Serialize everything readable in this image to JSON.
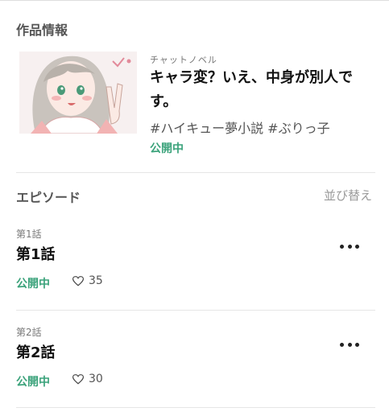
{
  "work_section": {
    "title": "作品情報",
    "category": "チャットノベル",
    "work_title": "キャラ変？いえ、中身が別人です。",
    "tags": "#ハイキュー夢小説 #ぶりっ子",
    "status": "公開中"
  },
  "episodes_section": {
    "title": "エピソード",
    "sort_label": "並び替え",
    "episodes": [
      {
        "number": "第1話",
        "title": "第1話",
        "status": "公開中",
        "likes": "35"
      },
      {
        "number": "第2話",
        "title": "第2話",
        "status": "公開中",
        "likes": "30"
      }
    ]
  },
  "colors": {
    "status_green": "#3aa27a",
    "muted_text": "#777777",
    "divider": "#e6e6e6"
  },
  "icons": {
    "like": "heart-icon",
    "more": "more-options-icon"
  }
}
